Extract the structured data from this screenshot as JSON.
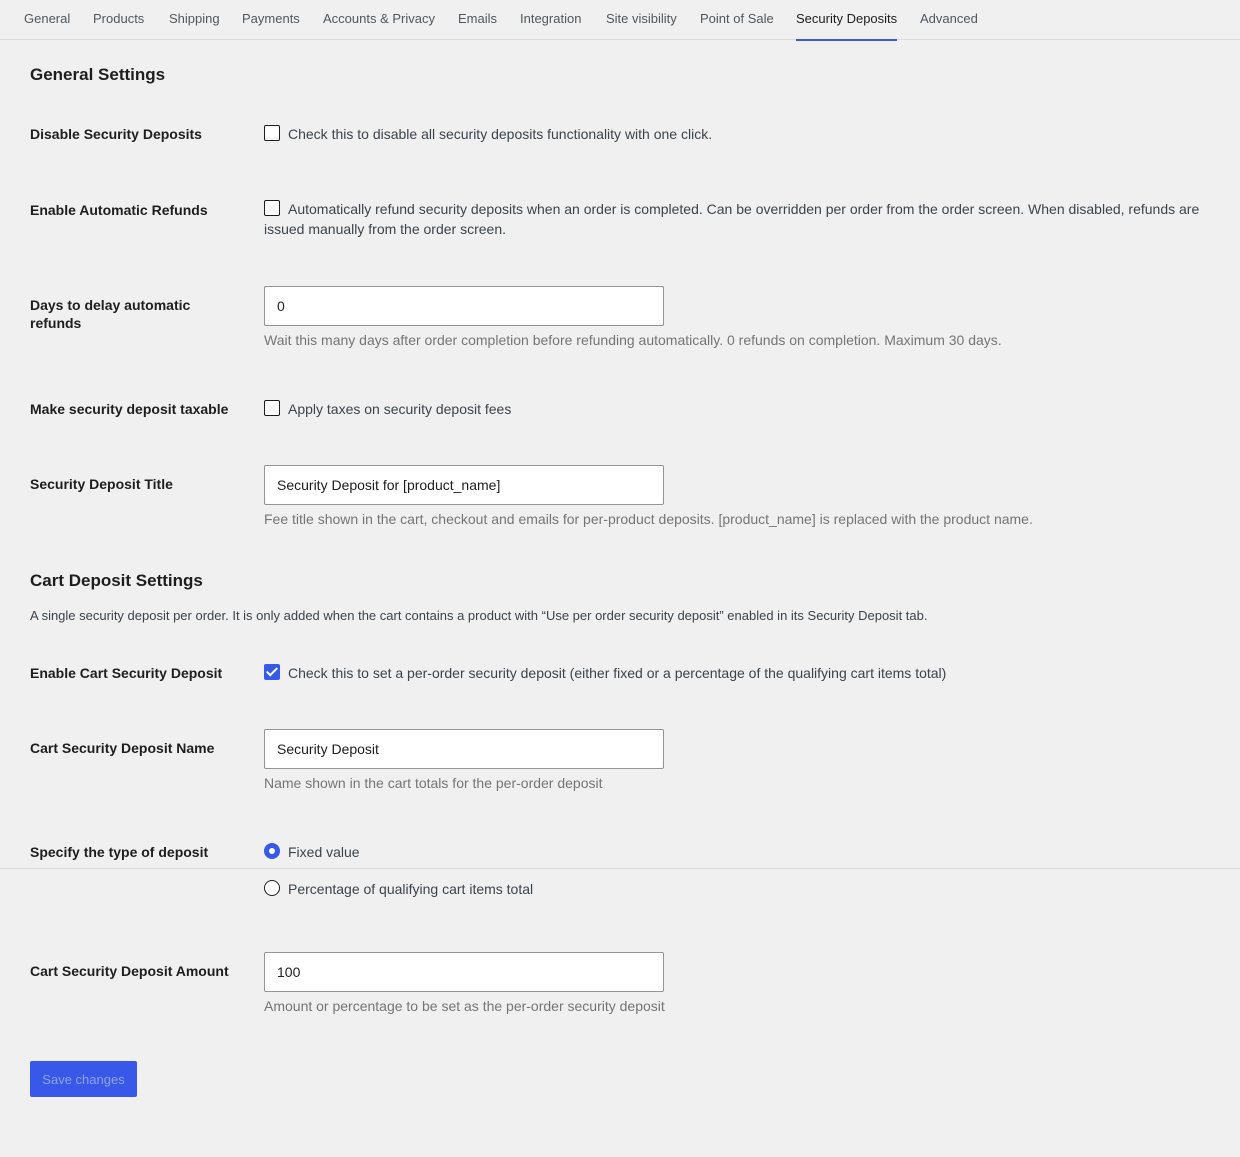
{
  "tabs": [
    {
      "label": "General"
    },
    {
      "label": "Products"
    },
    {
      "label": "Shipping"
    },
    {
      "label": "Payments"
    },
    {
      "label": "Accounts & Privacy"
    },
    {
      "label": "Emails"
    },
    {
      "label": "Integration"
    },
    {
      "label": "Site visibility"
    },
    {
      "label": "Point of Sale"
    },
    {
      "label": "Security Deposits",
      "active": true
    },
    {
      "label": "Advanced"
    }
  ],
  "general": {
    "heading": "General Settings",
    "disable": {
      "label": "Disable Security Deposits",
      "text": "Check this to disable all security deposits functionality with one click.",
      "checked": false
    },
    "auto_refunds": {
      "label": "Enable Automatic Refunds",
      "text": "Automatically refund security deposits when an order is completed. Can be overridden per order from the order screen. When disabled, refunds are issued manually from the order screen.",
      "checked": false
    },
    "delay_days": {
      "label": "Days to delay automatic refunds",
      "value": "0",
      "help": "Wait this many days after order completion before refunding automatically. 0 refunds on completion. Maximum 30 days."
    },
    "taxable": {
      "label": "Make security deposit taxable",
      "text": "Apply taxes on security deposit fees",
      "checked": false
    },
    "title": {
      "label": "Security Deposit Title",
      "value": "Security Deposit for [product_name]",
      "help": "Fee title shown in the cart, checkout and emails for per-product deposits. [product_name] is replaced with the product name."
    }
  },
  "cart": {
    "heading": "Cart Deposit Settings",
    "description": "A single security deposit per order. It is only added when the cart contains a product with “Use per order security deposit” enabled in its Security Deposit tab.",
    "enable": {
      "label": "Enable Cart Security Deposit",
      "text": "Check this to set a per-order security deposit (either fixed or a percentage of the qualifying cart items total)",
      "checked": true
    },
    "name": {
      "label": "Cart Security Deposit Name",
      "value": "Security Deposit",
      "help": "Name shown in the cart totals for the per-order deposit"
    },
    "type": {
      "label": "Specify the type of deposit",
      "options": [
        {
          "label": "Fixed value",
          "checked": true
        },
        {
          "label": "Percentage of qualifying cart items total",
          "checked": false
        }
      ]
    },
    "amount": {
      "label": "Cart Security Deposit Amount",
      "value": "100",
      "help": "Amount or percentage to be set as the per-order security deposit"
    }
  },
  "save_label": "Save changes",
  "colors": {
    "accent": "#3858e9",
    "background": "#f0f0f0"
  }
}
